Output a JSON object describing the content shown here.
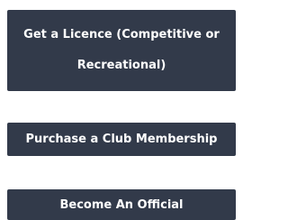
{
  "buttons": {
    "licence_line1": "Get a Licence (Competitive or",
    "licence_line2": "Recreational)",
    "membership": "Purchase a Club Membership",
    "official": "Become An Official"
  },
  "colors": {
    "button_bg": "#323a4a",
    "button_text": "#ffffff",
    "page_bg": "#ffffff"
  }
}
